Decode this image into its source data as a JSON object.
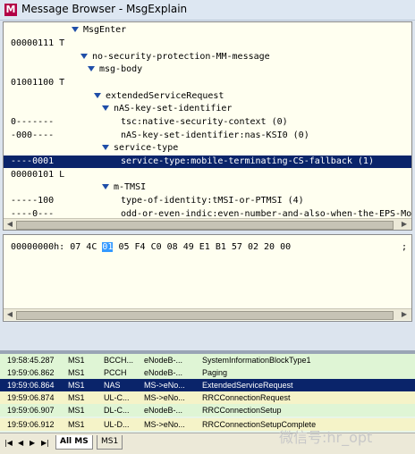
{
  "window": {
    "app_icon": "M",
    "title": "Message Browser - MsgExplain"
  },
  "tree_rows": [
    {
      "bits": "",
      "label": "MsgEnter",
      "expander": true
    },
    {
      "bits": "00000111 T",
      "label": "",
      "expander": false
    },
    {
      "bits": "",
      "label": "no-security-protection-MM-message",
      "expander": true
    },
    {
      "bits": "",
      "label": "msg-body",
      "expander": true
    },
    {
      "bits": "01001100 T",
      "label": "",
      "expander": false
    },
    {
      "bits": "",
      "label": "extendedServiceRequest",
      "expander": true
    },
    {
      "bits": "",
      "label": "nAS-key-set-identifier",
      "expander": true
    },
    {
      "bits": "0-------",
      "label": "tsc:native-security-context (0)",
      "expander": false
    },
    {
      "bits": "-000----",
      "label": "nAS-key-set-identifier:nas-KSI0 (0)",
      "expander": false
    },
    {
      "bits": "",
      "label": "service-type",
      "expander": true
    },
    {
      "bits": "----0001",
      "label": "service-type:mobile-terminating-CS-fallback (1)",
      "expander": false
    },
    {
      "bits": "00000101 L",
      "label": "",
      "expander": false
    },
    {
      "bits": "",
      "label": "m-TMSI",
      "expander": true
    },
    {
      "bits": "-----100",
      "label": "type-of-identity:tMSI-or-PTMSI (4)",
      "expander": false
    },
    {
      "bits": "----0---",
      "label": "odd-or-even-indic:even-number-and-also-when-the-EPS-Mobile-",
      "expander": false
    }
  ],
  "hex": {
    "offset": "00000000h:",
    "bytes_before": "07 4C",
    "selected_byte": "01",
    "bytes_after": "05 F4 C0 08 49 E1 B1 57 02 20 00",
    "trailing": ";"
  },
  "messages": [
    {
      "time": "19:58:45.287",
      "ms": "MS1",
      "channel": "BCCH...",
      "dir": "eNodeB-...",
      "name": "SystemInformationBlockType1",
      "style": "green"
    },
    {
      "time": "19:59:06.862",
      "ms": "MS1",
      "channel": "PCCH",
      "dir": "eNodeB-...",
      "name": "Paging",
      "style": "green"
    },
    {
      "time": "19:59:06.864",
      "ms": "MS1",
      "channel": "NAS",
      "dir": "MS->eNo...",
      "name": "ExtendedServiceRequest",
      "style": "sel"
    },
    {
      "time": "19:59:06.874",
      "ms": "MS1",
      "channel": "UL-C...",
      "dir": "MS->eNo...",
      "name": "RRCConnectionRequest",
      "style": "yellow"
    },
    {
      "time": "19:59:06.907",
      "ms": "MS1",
      "channel": "DL-C...",
      "dir": "eNodeB-...",
      "name": "RRCConnectionSetup",
      "style": "green"
    },
    {
      "time": "19:59:06.912",
      "ms": "MS1",
      "channel": "UL-D...",
      "dir": "MS->eNo...",
      "name": "RRCConnectionSetupComplete",
      "style": "yellow"
    }
  ],
  "tabs": {
    "all": "All MS",
    "ms1": "MS1"
  },
  "nav": [
    "|◀",
    "◀",
    "▶",
    "▶|"
  ],
  "watermark": "微信号:hr_opt"
}
